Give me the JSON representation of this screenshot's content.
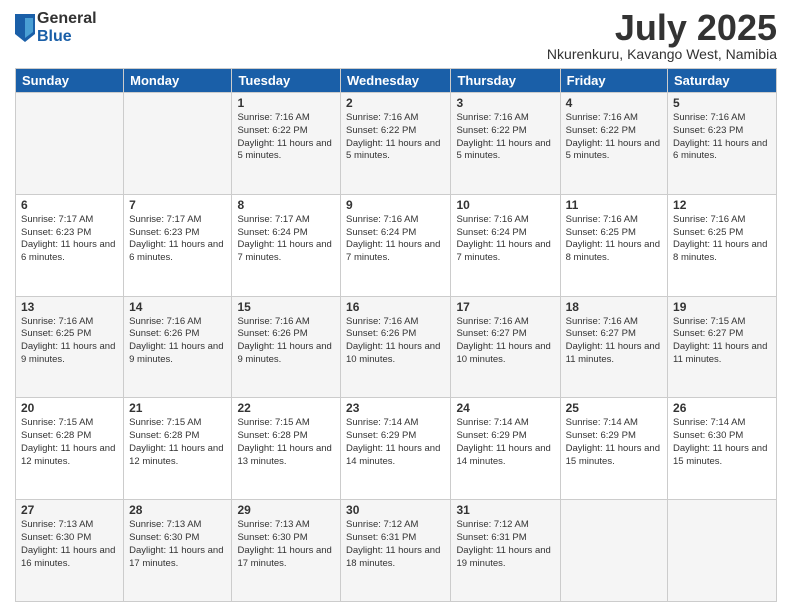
{
  "header": {
    "logo_general": "General",
    "logo_blue": "Blue",
    "month": "July 2025",
    "location": "Nkurenkuru, Kavango West, Namibia"
  },
  "weekdays": [
    "Sunday",
    "Monday",
    "Tuesday",
    "Wednesday",
    "Thursday",
    "Friday",
    "Saturday"
  ],
  "rows": [
    [
      {
        "day": "",
        "info": ""
      },
      {
        "day": "",
        "info": ""
      },
      {
        "day": "1",
        "info": "Sunrise: 7:16 AM\nSunset: 6:22 PM\nDaylight: 11 hours and 5 minutes."
      },
      {
        "day": "2",
        "info": "Sunrise: 7:16 AM\nSunset: 6:22 PM\nDaylight: 11 hours and 5 minutes."
      },
      {
        "day": "3",
        "info": "Sunrise: 7:16 AM\nSunset: 6:22 PM\nDaylight: 11 hours and 5 minutes."
      },
      {
        "day": "4",
        "info": "Sunrise: 7:16 AM\nSunset: 6:22 PM\nDaylight: 11 hours and 5 minutes."
      },
      {
        "day": "5",
        "info": "Sunrise: 7:16 AM\nSunset: 6:23 PM\nDaylight: 11 hours and 6 minutes."
      }
    ],
    [
      {
        "day": "6",
        "info": "Sunrise: 7:17 AM\nSunset: 6:23 PM\nDaylight: 11 hours and 6 minutes."
      },
      {
        "day": "7",
        "info": "Sunrise: 7:17 AM\nSunset: 6:23 PM\nDaylight: 11 hours and 6 minutes."
      },
      {
        "day": "8",
        "info": "Sunrise: 7:17 AM\nSunset: 6:24 PM\nDaylight: 11 hours and 7 minutes."
      },
      {
        "day": "9",
        "info": "Sunrise: 7:16 AM\nSunset: 6:24 PM\nDaylight: 11 hours and 7 minutes."
      },
      {
        "day": "10",
        "info": "Sunrise: 7:16 AM\nSunset: 6:24 PM\nDaylight: 11 hours and 7 minutes."
      },
      {
        "day": "11",
        "info": "Sunrise: 7:16 AM\nSunset: 6:25 PM\nDaylight: 11 hours and 8 minutes."
      },
      {
        "day": "12",
        "info": "Sunrise: 7:16 AM\nSunset: 6:25 PM\nDaylight: 11 hours and 8 minutes."
      }
    ],
    [
      {
        "day": "13",
        "info": "Sunrise: 7:16 AM\nSunset: 6:25 PM\nDaylight: 11 hours and 9 minutes."
      },
      {
        "day": "14",
        "info": "Sunrise: 7:16 AM\nSunset: 6:26 PM\nDaylight: 11 hours and 9 minutes."
      },
      {
        "day": "15",
        "info": "Sunrise: 7:16 AM\nSunset: 6:26 PM\nDaylight: 11 hours and 9 minutes."
      },
      {
        "day": "16",
        "info": "Sunrise: 7:16 AM\nSunset: 6:26 PM\nDaylight: 11 hours and 10 minutes."
      },
      {
        "day": "17",
        "info": "Sunrise: 7:16 AM\nSunset: 6:27 PM\nDaylight: 11 hours and 10 minutes."
      },
      {
        "day": "18",
        "info": "Sunrise: 7:16 AM\nSunset: 6:27 PM\nDaylight: 11 hours and 11 minutes."
      },
      {
        "day": "19",
        "info": "Sunrise: 7:15 AM\nSunset: 6:27 PM\nDaylight: 11 hours and 11 minutes."
      }
    ],
    [
      {
        "day": "20",
        "info": "Sunrise: 7:15 AM\nSunset: 6:28 PM\nDaylight: 11 hours and 12 minutes."
      },
      {
        "day": "21",
        "info": "Sunrise: 7:15 AM\nSunset: 6:28 PM\nDaylight: 11 hours and 12 minutes."
      },
      {
        "day": "22",
        "info": "Sunrise: 7:15 AM\nSunset: 6:28 PM\nDaylight: 11 hours and 13 minutes."
      },
      {
        "day": "23",
        "info": "Sunrise: 7:14 AM\nSunset: 6:29 PM\nDaylight: 11 hours and 14 minutes."
      },
      {
        "day": "24",
        "info": "Sunrise: 7:14 AM\nSunset: 6:29 PM\nDaylight: 11 hours and 14 minutes."
      },
      {
        "day": "25",
        "info": "Sunrise: 7:14 AM\nSunset: 6:29 PM\nDaylight: 11 hours and 15 minutes."
      },
      {
        "day": "26",
        "info": "Sunrise: 7:14 AM\nSunset: 6:30 PM\nDaylight: 11 hours and 15 minutes."
      }
    ],
    [
      {
        "day": "27",
        "info": "Sunrise: 7:13 AM\nSunset: 6:30 PM\nDaylight: 11 hours and 16 minutes."
      },
      {
        "day": "28",
        "info": "Sunrise: 7:13 AM\nSunset: 6:30 PM\nDaylight: 11 hours and 17 minutes."
      },
      {
        "day": "29",
        "info": "Sunrise: 7:13 AM\nSunset: 6:30 PM\nDaylight: 11 hours and 17 minutes."
      },
      {
        "day": "30",
        "info": "Sunrise: 7:12 AM\nSunset: 6:31 PM\nDaylight: 11 hours and 18 minutes."
      },
      {
        "day": "31",
        "info": "Sunrise: 7:12 AM\nSunset: 6:31 PM\nDaylight: 11 hours and 19 minutes."
      },
      {
        "day": "",
        "info": ""
      },
      {
        "day": "",
        "info": ""
      }
    ]
  ]
}
